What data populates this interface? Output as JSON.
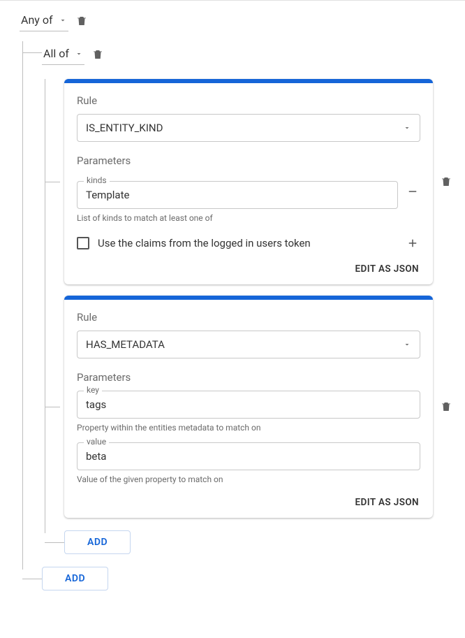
{
  "root": {
    "label": "Any of",
    "children": [
      {
        "label": "All of",
        "rules": [
          {
            "section_label": "Rule",
            "rule_value": "IS_ENTITY_KIND",
            "param_label": "Parameters",
            "field_label": "kinds",
            "field_value": "Template",
            "helper": "List of kinds to match at least one of",
            "checkbox_label": "Use the claims from the logged in users token",
            "edit_json": "EDIT AS JSON"
          },
          {
            "section_label": "Rule",
            "rule_value": "HAS_METADATA",
            "param_label": "Parameters",
            "key_label": "key",
            "key_value": "tags",
            "key_helper": "Property within the entities metadata to match on",
            "value_label": "value",
            "value_value": "beta",
            "value_helper": "Value of the given property to match on",
            "edit_json": "EDIT AS JSON"
          }
        ],
        "add_label": "ADD"
      }
    ],
    "add_label": "ADD"
  }
}
